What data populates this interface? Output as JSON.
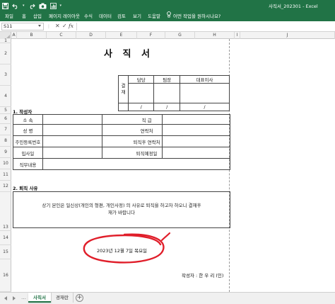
{
  "window": {
    "document_title": "사직서_202301  -  Excel"
  },
  "ribbon_tabs": [
    "파일",
    "홈",
    "삽입",
    "페이지 레이아웃",
    "수식",
    "데이터",
    "검토",
    "보기",
    "도움말"
  ],
  "tell_me": {
    "placeholder": "어떤 작업을 원하시나요?"
  },
  "formula_bar": {
    "name_box": "S11",
    "fx_label": "fx",
    "value": ""
  },
  "columns": [
    "A",
    "B",
    "C",
    "D",
    "E",
    "F",
    "G",
    "H",
    "I",
    "J"
  ],
  "rows": [
    "1",
    "2",
    "3",
    "4",
    "5",
    "6",
    "7",
    "8",
    "9",
    "10",
    "11",
    "12",
    "13",
    "14",
    "15",
    "16"
  ],
  "document": {
    "title": "사 직 서",
    "approval": {
      "side_label_1": "결",
      "side_label_2": "재",
      "headers": [
        "담당",
        "팀장",
        "대표이사"
      ],
      "date_slashes": [
        "/",
        "/",
        "/"
      ]
    },
    "section1_title": "1. 작성자",
    "writer_table": {
      "labels_left": [
        "소   속",
        "성   명",
        "주민등록번호",
        "입사일",
        "직무내용"
      ],
      "labels_right": [
        "직   급",
        "연락처",
        "퇴직후 연락처",
        "퇴직예정일"
      ]
    },
    "section2_title": "2. 퇴직 사유",
    "reason_line1": "상기 본인은 일신상(개인의 형편, 개인사정) 의 사유로 퇴직을 하고자 하오니 결재후",
    "reason_line2": "재가 바랍니다",
    "date": "2023년 12월 7일 목요일",
    "writer": "작성자 : 한 우 리 (인)"
  },
  "sheet_tabs": [
    {
      "label": "사직서",
      "active": true
    },
    {
      "label": "경재란",
      "active": false
    }
  ],
  "colors": {
    "excel_green": "#217346",
    "annotation_red": "#e01e2a"
  }
}
